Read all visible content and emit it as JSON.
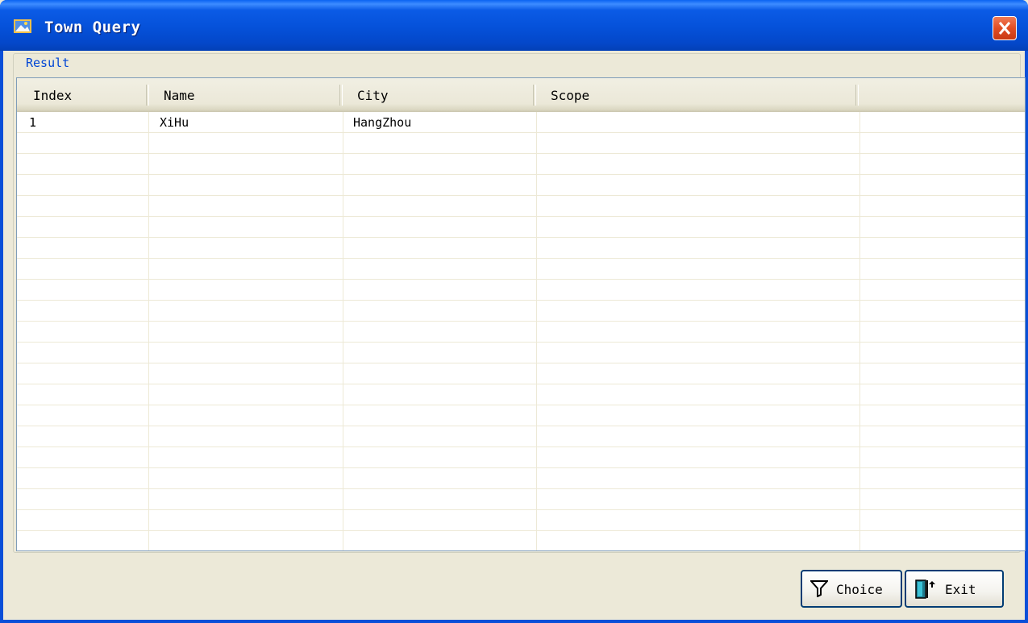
{
  "window": {
    "title": "Town Query",
    "accent": "#0a54e0",
    "close_color": "#e14d23"
  },
  "icons": {
    "app": "app-picture-icon",
    "close": "close-icon",
    "choice": "funnel-filter-icon",
    "exit": "door-exit-icon"
  },
  "group": {
    "label": "Result"
  },
  "table": {
    "columns": [
      "Index",
      "Name",
      "City",
      "Scope",
      ""
    ],
    "rows": [
      [
        "1",
        "XiHu",
        "HangZhou",
        "",
        ""
      ],
      [
        "",
        "",
        "",
        "",
        ""
      ],
      [
        "",
        "",
        "",
        "",
        ""
      ],
      [
        "",
        "",
        "",
        "",
        ""
      ],
      [
        "",
        "",
        "",
        "",
        ""
      ],
      [
        "",
        "",
        "",
        "",
        ""
      ],
      [
        "",
        "",
        "",
        "",
        ""
      ],
      [
        "",
        "",
        "",
        "",
        ""
      ],
      [
        "",
        "",
        "",
        "",
        ""
      ],
      [
        "",
        "",
        "",
        "",
        ""
      ],
      [
        "",
        "",
        "",
        "",
        ""
      ],
      [
        "",
        "",
        "",
        "",
        ""
      ],
      [
        "",
        "",
        "",
        "",
        ""
      ],
      [
        "",
        "",
        "",
        "",
        ""
      ],
      [
        "",
        "",
        "",
        "",
        ""
      ],
      [
        "",
        "",
        "",
        "",
        ""
      ],
      [
        "",
        "",
        "",
        "",
        ""
      ],
      [
        "",
        "",
        "",
        "",
        ""
      ],
      [
        "",
        "",
        "",
        "",
        ""
      ],
      [
        "",
        "",
        "",
        "",
        ""
      ],
      [
        "",
        "",
        "",
        "",
        ""
      ]
    ]
  },
  "buttons": {
    "choice": "Choice",
    "exit": "Exit"
  }
}
